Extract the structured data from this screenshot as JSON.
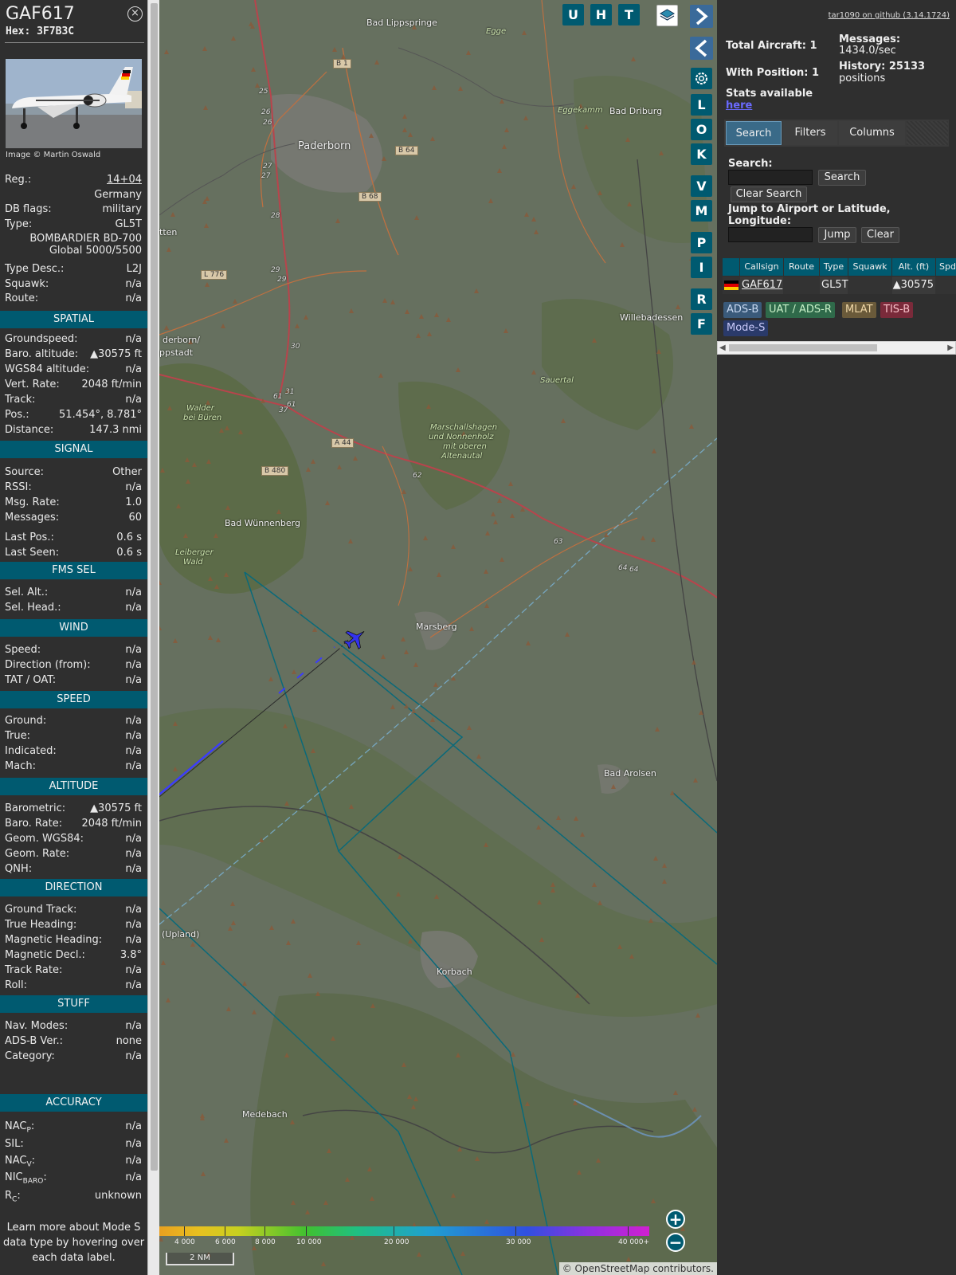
{
  "sidebar": {
    "callsign": "GAF617",
    "hex_label": "Hex: 3F7B3C",
    "close_glyph": "×",
    "photo_credit": "Image © Martin Oswald",
    "general": [
      {
        "label": "Reg.:",
        "value": "14+04"
      },
      {
        "label": "",
        "value": "Germany"
      },
      {
        "label": "DB flags:",
        "value": "military"
      },
      {
        "label": "Type:",
        "value": "GL5T"
      }
    ],
    "type_full_1": "BOMBARDIER BD-700",
    "type_full_2": "Global 5000/5500",
    "general2": [
      {
        "label": "Type Desc.:",
        "value": "L2J"
      },
      {
        "label": "Squawk:",
        "value": "n/a"
      },
      {
        "label": "Route:",
        "value": "n/a"
      }
    ],
    "sections": [
      {
        "title": "SPATIAL",
        "rows": [
          {
            "label": "Groundspeed:",
            "value": "n/a"
          },
          {
            "label": "Baro. altitude:",
            "value": "▲30575 ft"
          },
          {
            "label": "WGS84 altitude:",
            "value": "n/a"
          },
          {
            "label": "Vert. Rate:",
            "value": "2048 ft/min"
          },
          {
            "label": "Track:",
            "value": "n/a"
          },
          {
            "label": "Pos.:",
            "value": "51.454°, 8.781°"
          },
          {
            "label": "Distance:",
            "value": "147.3 nmi"
          }
        ]
      },
      {
        "title": "SIGNAL",
        "rows": [
          {
            "label": "Source:",
            "value": "Other"
          },
          {
            "label": "RSSI:",
            "value": "n/a"
          },
          {
            "label": "Msg. Rate:",
            "value": "1.0"
          },
          {
            "label": "Messages:",
            "value": "60"
          },
          {
            "label": "Last Pos.:",
            "value": "0.6 s"
          },
          {
            "label": "Last Seen:",
            "value": "0.6 s"
          }
        ]
      },
      {
        "title": "FMS SEL",
        "rows": [
          {
            "label": "Sel. Alt.:",
            "value": "n/a"
          },
          {
            "label": "Sel. Head.:",
            "value": "n/a"
          }
        ]
      },
      {
        "title": "WIND",
        "rows": [
          {
            "label": "Speed:",
            "value": "n/a"
          },
          {
            "label": "Direction (from):",
            "value": "n/a"
          },
          {
            "label": "TAT / OAT:",
            "value": "n/a"
          }
        ]
      },
      {
        "title": "SPEED",
        "rows": [
          {
            "label": "Ground:",
            "value": "n/a"
          },
          {
            "label": "True:",
            "value": "n/a"
          },
          {
            "label": "Indicated:",
            "value": "n/a"
          },
          {
            "label": "Mach:",
            "value": "n/a"
          }
        ]
      },
      {
        "title": "ALTITUDE",
        "rows": [
          {
            "label": "Barometric:",
            "value": "▲30575 ft"
          },
          {
            "label": "Baro. Rate:",
            "value": "2048 ft/min"
          },
          {
            "label": "Geom. WGS84:",
            "value": "n/a"
          },
          {
            "label": "Geom. Rate:",
            "value": "n/a"
          },
          {
            "label": "QNH:",
            "value": "n/a"
          }
        ]
      },
      {
        "title": "DIRECTION",
        "rows": [
          {
            "label": "Ground Track:",
            "value": "n/a"
          },
          {
            "label": "True Heading:",
            "value": "n/a"
          },
          {
            "label": "Magnetic Heading:",
            "value": "n/a"
          },
          {
            "label": "Magnetic Decl.:",
            "value": "3.8°"
          },
          {
            "label": "Track Rate:",
            "value": "n/a"
          },
          {
            "label": "Roll:",
            "value": "n/a"
          }
        ]
      },
      {
        "title": "STUFF",
        "rows": [
          {
            "label": "Nav. Modes:",
            "value": "n/a"
          },
          {
            "label": "ADS-B Ver.:",
            "value": "none"
          },
          {
            "label": "Category:",
            "value": "n/a"
          }
        ]
      }
    ],
    "accuracy_title": "ACCURACY",
    "accuracy": [
      {
        "base": "NAC",
        "sub": "P",
        "value": "n/a"
      },
      {
        "base": "SIL:",
        "sub": "",
        "value": "n/a"
      },
      {
        "base": "NAC",
        "sub": "V",
        "value": "n/a"
      },
      {
        "base": "NIC",
        "sub": "BARO",
        "value": "n/a"
      },
      {
        "base": "R",
        "sub": "C",
        "value": "unknown"
      }
    ],
    "learn_more_1": "Learn more about Mode S",
    "learn_more_2": "data type by hovering over",
    "learn_more_3": "each data label."
  },
  "map": {
    "top_buttons": [
      "U",
      "H",
      "T"
    ],
    "side_buttons": [
      "L",
      "O",
      "K",
      "V",
      "M",
      "P",
      "I",
      "R",
      "F"
    ],
    "places": [
      {
        "name": "Bad Lippspringe"
      },
      {
        "name": "Egge"
      },
      {
        "name": "Eggekamm"
      },
      {
        "name": "Bad Driburg"
      },
      {
        "name": "Paderborn"
      },
      {
        "name": "tten"
      },
      {
        "name": "Willebadessen"
      },
      {
        "name": "derborn/"
      },
      {
        "name": "ppstadt"
      },
      {
        "name": "Sauertal"
      },
      {
        "name": "Walder"
      },
      {
        "name": "bei Büren"
      },
      {
        "name": "Marschallshagen"
      },
      {
        "name": "und Nonnenholz"
      },
      {
        "name": "mit oberen"
      },
      {
        "name": "Altenautal"
      },
      {
        "name": "Bad Wünnenberg"
      },
      {
        "name": "Leiberger"
      },
      {
        "name": "Wald"
      },
      {
        "name": "Marsberg"
      },
      {
        "name": "Bad Arolsen"
      },
      {
        "name": "(Upland)"
      },
      {
        "name": "Korbach"
      },
      {
        "name": "Medebach"
      }
    ],
    "roads": [
      "B 1",
      "B 64",
      "B 68",
      "L 776",
      "A 44",
      "B 480"
    ],
    "road_numbers": [
      "25",
      "26",
      "26",
      "27",
      "27",
      "28",
      "29",
      "29",
      "30",
      "31",
      "61",
      "61",
      "37",
      "62",
      "63",
      "64",
      "64"
    ],
    "altitude_scale": [
      "4 000",
      "6 000",
      "8 000",
      "10 000",
      "20 000",
      "30 000",
      "40 000+"
    ],
    "distance_scale": "2 NM",
    "attribution_prefix": "©",
    "attribution_link": "OpenStreetMap",
    "attribution_suffix": "contributors.",
    "zoom_in": "+",
    "zoom_out": "−"
  },
  "right": {
    "github_link": "tar1090 on github (3.14.1724)",
    "total_aircraft": "Total Aircraft: 1",
    "with_position": "With Position: 1",
    "messages_1": "Messages:",
    "messages_2": "1434.0/sec",
    "history_1": "History: 25133",
    "history_2": "positions",
    "stats_text": "Stats available",
    "stats_link": "here",
    "tabs": [
      "Search",
      "Filters",
      "Columns"
    ],
    "search_label": "Search:",
    "search_button": "Search",
    "clear_search_button": "Clear Search",
    "jump_label_1": "Jump to Airport or Latitude,",
    "jump_label_2": "Longitude:",
    "jump_button": "Jump",
    "clear_button": "Clear",
    "table_headers": [
      "Callsign",
      "Route",
      "Type",
      "Squawk",
      "Alt. (ft)",
      "Spd"
    ],
    "table_row": {
      "callsign": "GAF617",
      "route": "",
      "type": "GL5T",
      "squawk": "",
      "alt": "▲30575"
    },
    "legend": [
      {
        "label": "ADS-B",
        "color": "#3a5a7a"
      },
      {
        "label": "UAT / ADS-R",
        "color": "#2f6a4a"
      },
      {
        "label": "MLAT",
        "color": "#6a5a3a"
      },
      {
        "label": "TIS-B",
        "color": "#7a2a3a"
      },
      {
        "label": "Mode-S",
        "color": "#2a3a6a"
      }
    ]
  }
}
